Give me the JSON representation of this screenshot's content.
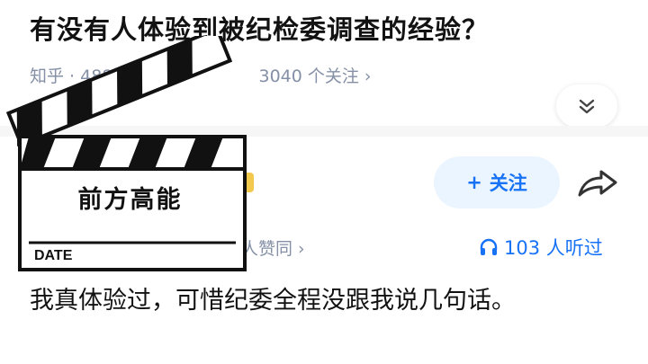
{
  "question": {
    "title": "有没有人体验到被纪检委调查的经验？",
    "meta_left": "知乎 · 488",
    "meta_right": "3040 个关注 ›"
  },
  "answer_header": {
    "follow_label": "关注",
    "agree_fragment": "人赞同 ›",
    "listen_count": "103 人听过"
  },
  "answer": {
    "body": "我真体验过，可惜纪委全程没跟我说几句话。"
  },
  "sticker": {
    "label": "前方高能",
    "date_label": "DATE"
  },
  "colors": {
    "accent": "#1772f6",
    "follow_bg": "#ebf5ff",
    "meta_gray": "#8590a6"
  },
  "icons": [
    "chevron-double-down-icon",
    "plus-icon",
    "share-icon",
    "headphones-icon",
    "clapperboard-sticker"
  ]
}
